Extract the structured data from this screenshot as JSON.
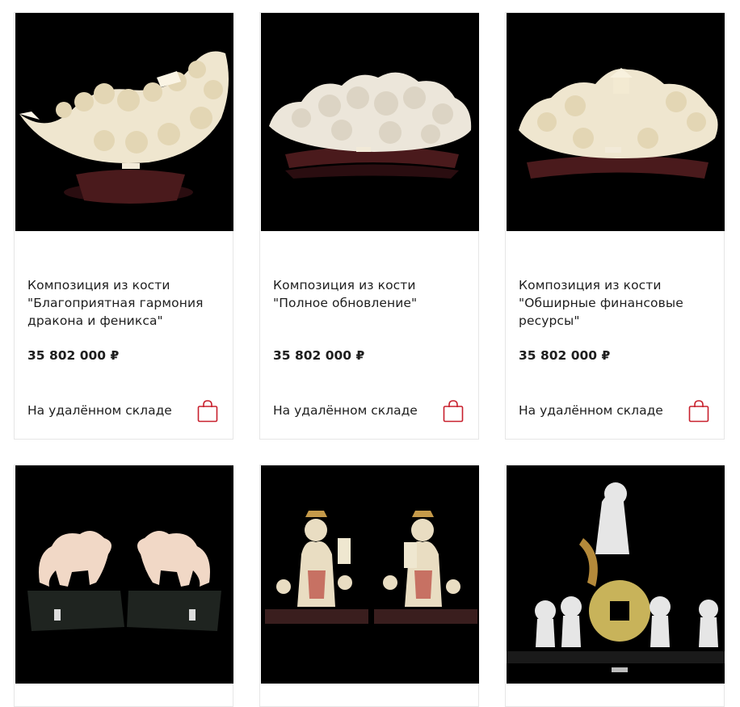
{
  "products": [
    {
      "title": "Композиция из кости \"Благоприятная гармония дракона и феникса\"",
      "price": "35 802 000 ₽",
      "availability": "На удалённом складе",
      "image_alt": "bone-carving-dragon-phoenix",
      "cart_icon": "shopping-bag-icon"
    },
    {
      "title": "Композиция из кости \"Полное обновление\"",
      "price": "35 802 000 ₽",
      "availability": "На удалённом складе",
      "image_alt": "bone-carving-renewal",
      "cart_icon": "shopping-bag-icon"
    },
    {
      "title": "Композиция из кости \"Обширные финансовые ресурсы\"",
      "price": "35 802 000 ₽",
      "availability": "На удалённом складе",
      "image_alt": "bone-carving-financial-resources",
      "cart_icon": "shopping-bag-icon"
    },
    {
      "image_alt": "bone-carving-qilin-pair"
    },
    {
      "image_alt": "bone-carving-wealth-gods"
    },
    {
      "image_alt": "bone-carving-coin-children"
    }
  ],
  "colors": {
    "accent": "#c8202d",
    "border": "#e6e6e6",
    "image_bg": "#000000",
    "ivory": "#efe6cf",
    "base_dark": "#3a1416"
  }
}
